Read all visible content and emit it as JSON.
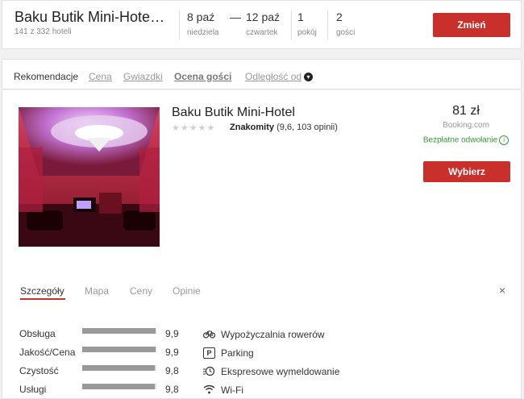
{
  "header": {
    "hotel_name": "Baku Butik Mini-Hote…",
    "hotel_count": "141 z 332 hoteli",
    "checkin_date": "8 paź",
    "checkin_day": "niedziela",
    "dash": "—",
    "checkout_date": "12 paź",
    "checkout_day": "czwartek",
    "rooms_count": "1",
    "rooms_label": "pokój",
    "guests_count": "2",
    "guests_label": "gości",
    "change_label": "Zmień"
  },
  "sort": {
    "label": "Rekomendacje",
    "options": [
      "Cena",
      "Gwiazdki",
      "Ocena gości",
      "Odległość od"
    ]
  },
  "hotel": {
    "name": "Baku Butik Mini-Hotel",
    "stars": "★★★★★",
    "rating_word": "Znakomity",
    "rating_detail": "(9,6, 103 opinii)",
    "price": "81 zł",
    "source": "Booking.com",
    "free_cancel": "Bezpłatne odwołanie",
    "select_label": "Wybierz"
  },
  "tabs": [
    "Szczegóły",
    "Mapa",
    "Ceny",
    "Opinie"
  ],
  "close_symbol": "×",
  "scores": [
    {
      "label": "Obsługa",
      "value": "9,9",
      "level": 0.99
    },
    {
      "label": "Jakość/Cena",
      "value": "9,9",
      "level": 0.99
    },
    {
      "label": "Czystość",
      "value": "9,8",
      "level": 0.98
    },
    {
      "label": "Usługi",
      "value": "9,8",
      "level": 0.98
    }
  ],
  "amenities": [
    {
      "icon": "bicycle-icon",
      "label": "Wypożyczalnia rowerów"
    },
    {
      "icon": "parking-icon",
      "label": "Parking"
    },
    {
      "icon": "express-checkout-icon",
      "label": "Ekspresowe wymeldowanie"
    },
    {
      "icon": "wifi-icon",
      "label": "Wi-Fi"
    }
  ]
}
